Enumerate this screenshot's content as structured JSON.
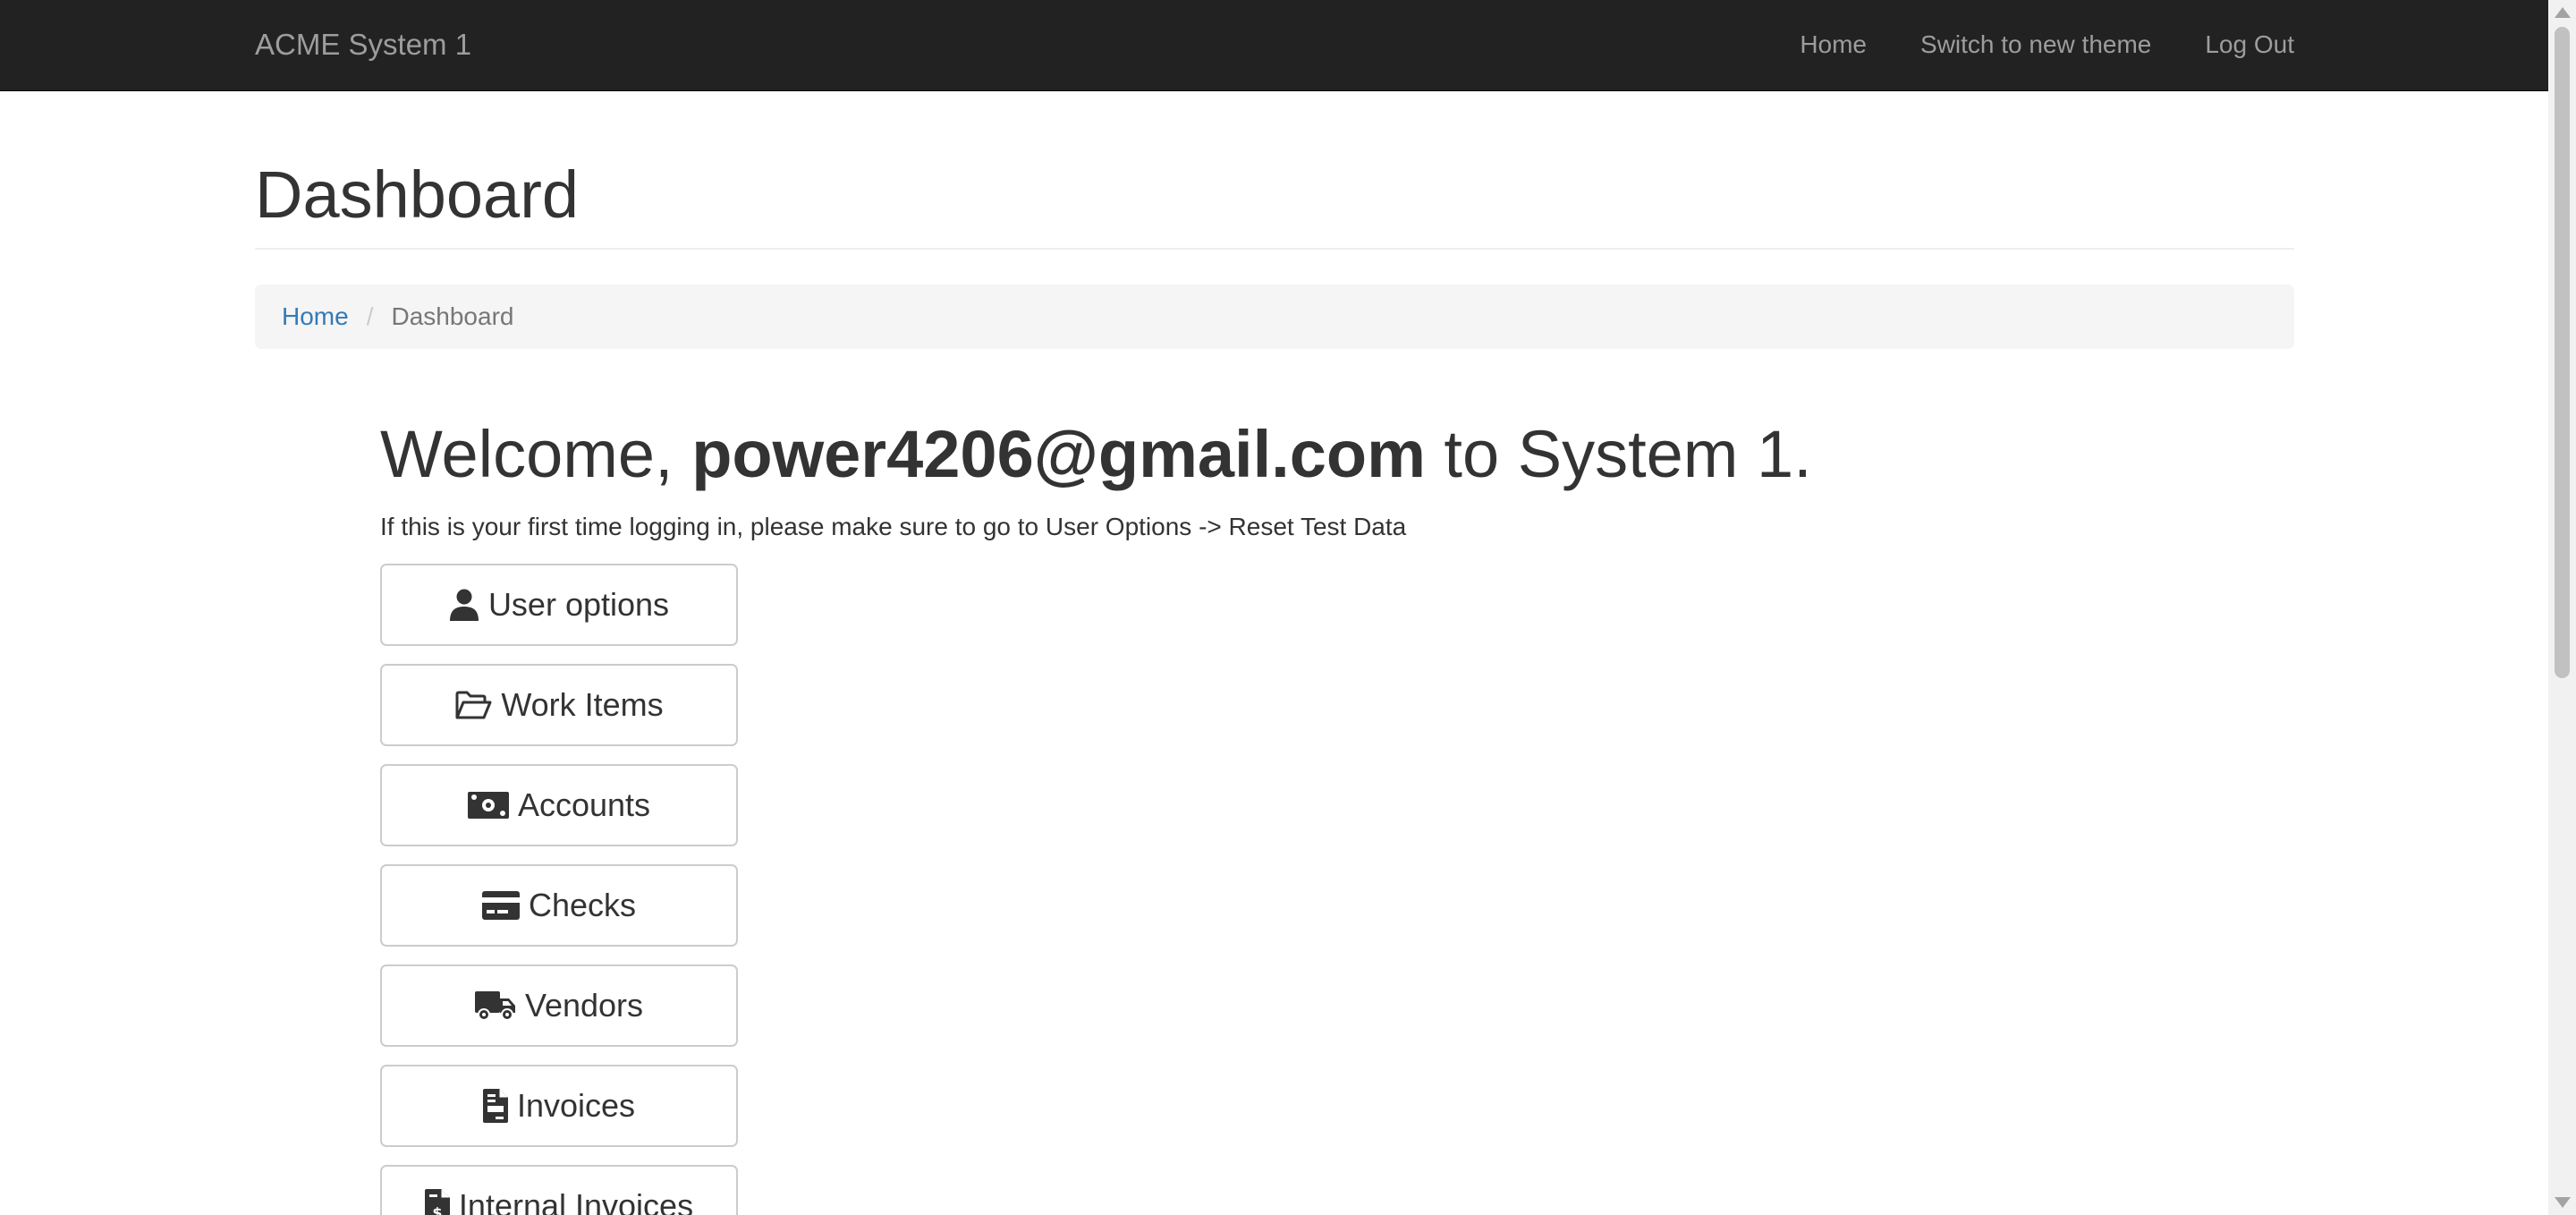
{
  "navbar": {
    "brand": "ACME System 1",
    "links": [
      "Home",
      "Switch to new theme",
      "Log Out"
    ]
  },
  "page": {
    "title": "Dashboard"
  },
  "breadcrumb": {
    "home": "Home",
    "separator": "/",
    "current": "Dashboard"
  },
  "welcome": {
    "prefix": "Welcome, ",
    "email": "power4206@gmail.com",
    "suffix": " to System 1.",
    "hint": "If this is your first time logging in, please make sure to go to User Options -> Reset Test Data"
  },
  "menu": [
    {
      "label": "User options",
      "icon": "user-icon"
    },
    {
      "label": "Work Items",
      "icon": "folder-open-icon"
    },
    {
      "label": "Accounts",
      "icon": "money-bill-icon"
    },
    {
      "label": "Checks",
      "icon": "credit-card-icon"
    },
    {
      "label": "Vendors",
      "icon": "truck-icon"
    },
    {
      "label": "Invoices",
      "icon": "file-invoice-icon"
    },
    {
      "label": "Internal Invoices",
      "icon": "file-invoice-dollar-icon"
    }
  ],
  "colors": {
    "navbar_bg": "#222222",
    "navbar_text": "#9d9d9d",
    "link": "#337ab7",
    "breadcrumb_bg": "#f5f5f5"
  }
}
